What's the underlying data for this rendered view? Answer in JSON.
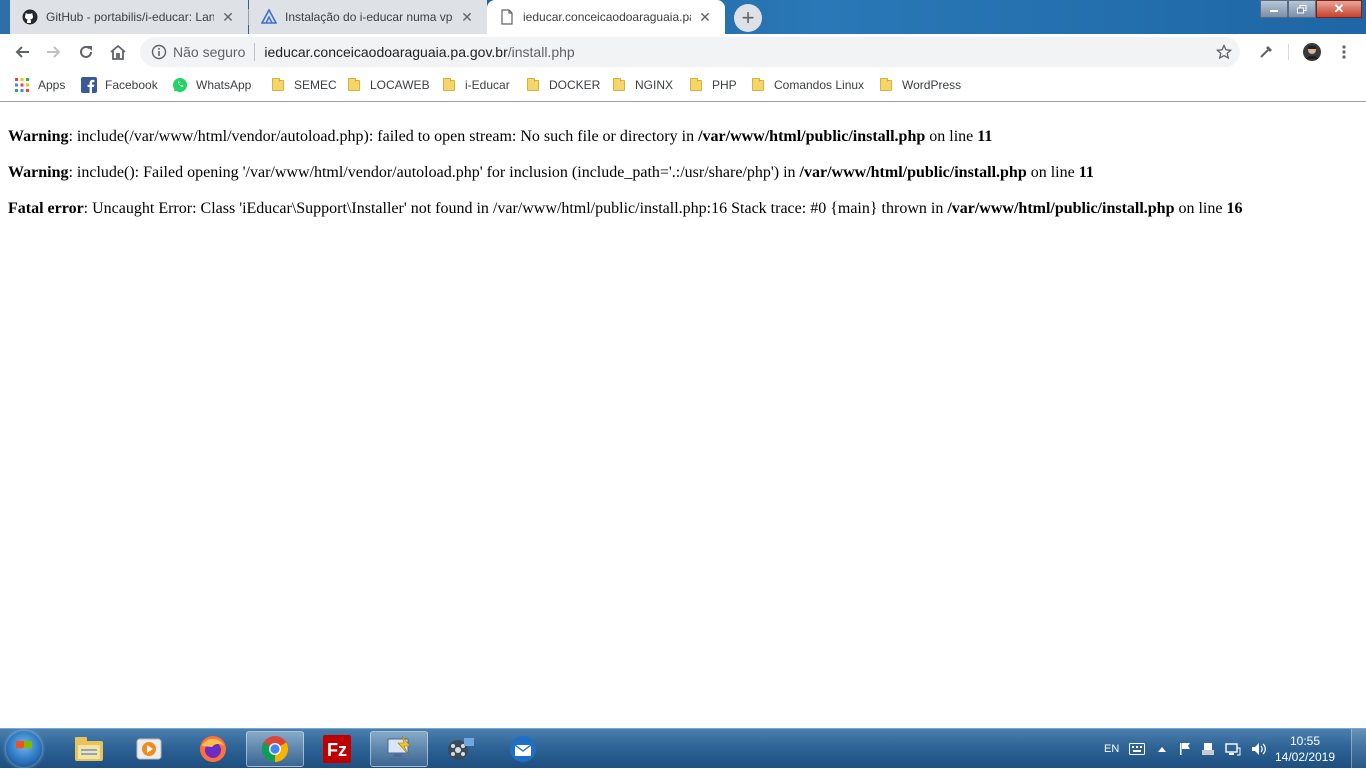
{
  "browser": {
    "tabs": [
      {
        "title": "GitHub - portabilis/i-educar: Lanç",
        "icon": "github-icon",
        "active": false
      },
      {
        "title": "Instalação do i-educar numa vps",
        "icon": "site-logo-icon",
        "active": false
      },
      {
        "title": "ieducar.conceicaodoaraguaia.pa.g",
        "icon": "page-icon",
        "active": true
      }
    ],
    "new_tab_label": "+",
    "address": {
      "security_label": "Não seguro",
      "host": "ieducar.conceicaodoaraguaia.pa.gov.br",
      "path": "/install.php"
    },
    "bookmarks": [
      {
        "label": "Apps",
        "icon": "apps-grid-icon"
      },
      {
        "label": "Facebook",
        "icon": "facebook-icon"
      },
      {
        "label": "WhatsApp",
        "icon": "whatsapp-icon"
      },
      {
        "label": "SEMEC",
        "icon": "folder-icon"
      },
      {
        "label": "LOCAWEB",
        "icon": "folder-icon"
      },
      {
        "label": "i-Educar",
        "icon": "folder-icon"
      },
      {
        "label": "DOCKER",
        "icon": "folder-icon"
      },
      {
        "label": "NGINX",
        "icon": "folder-icon"
      },
      {
        "label": "PHP",
        "icon": "folder-icon"
      },
      {
        "label": "Comandos Linux",
        "icon": "folder-icon"
      },
      {
        "label": "WordPress",
        "icon": "folder-icon"
      }
    ]
  },
  "page": {
    "messages": [
      {
        "level": "Warning",
        "text": ": include(/var/www/html/vendor/autoload.php): failed to open stream: No such file or directory in ",
        "file": "/var/www/html/public/install.php",
        "line_text": " on line ",
        "line": "11"
      },
      {
        "level": "Warning",
        "text": ": include(): Failed opening '/var/www/html/vendor/autoload.php' for inclusion (include_path='.:/usr/share/php') in ",
        "file": "/var/www/html/public/install.php",
        "line_text": " on line ",
        "line": "11"
      },
      {
        "level": "Fatal error",
        "text": ": Uncaught Error: Class 'iEducar\\Support\\Installer' not found in /var/www/html/public/install.php:16 Stack trace: #0 {main} thrown in ",
        "file": "/var/www/html/public/install.php",
        "line_text": " on line ",
        "line": "16"
      }
    ]
  },
  "taskbar": {
    "apps": [
      "explorer-icon",
      "media-player-icon",
      "firefox-icon",
      "chrome-icon",
      "filezilla-icon",
      "remote-desktop-icon",
      "video-app-icon",
      "thunderbird-icon"
    ],
    "language": "EN",
    "time": "10:55",
    "date": "14/02/2019"
  },
  "colors": {
    "titlebar": "#1d5d95",
    "tab_inactive": "#dee1e6",
    "taskbar": "#2f6496"
  }
}
